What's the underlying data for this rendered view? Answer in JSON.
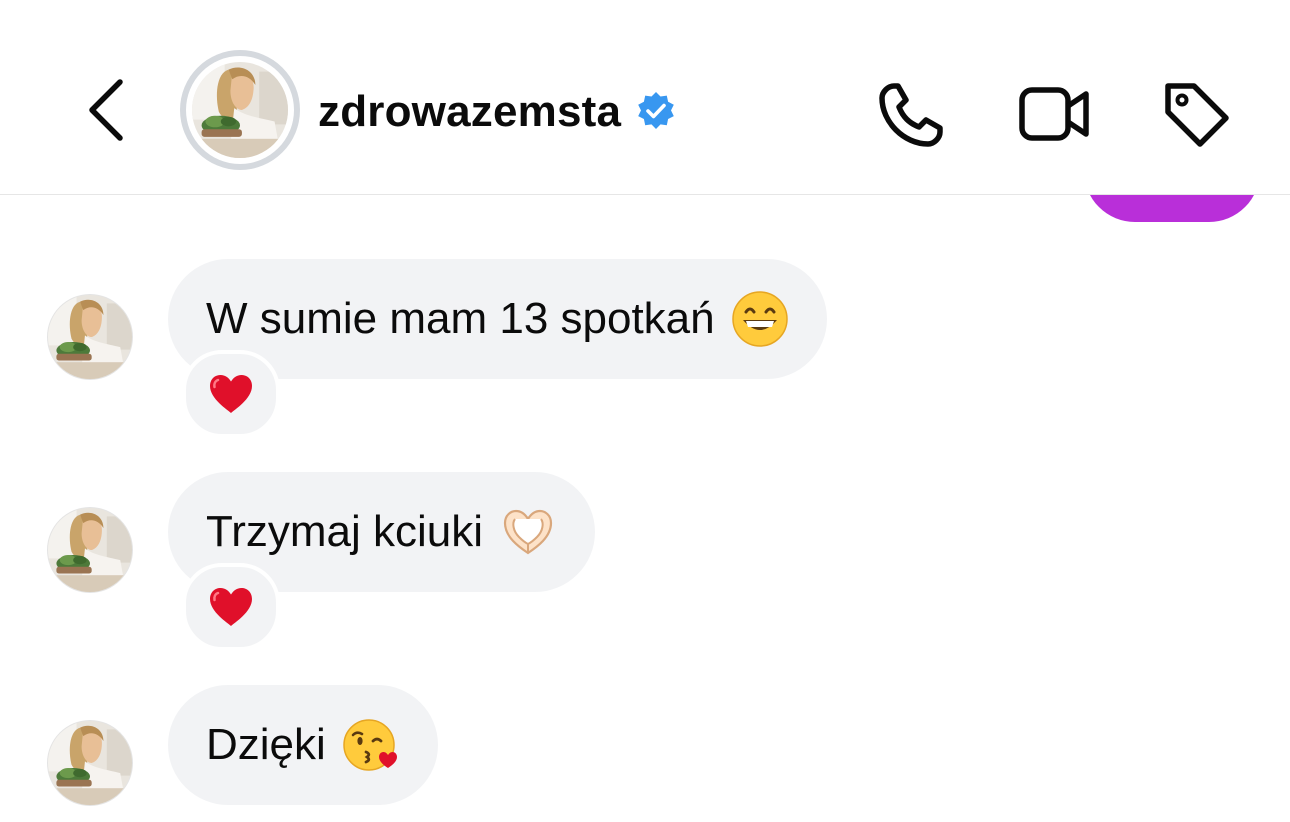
{
  "header": {
    "username": "zdrowazemsta",
    "verified": true,
    "icons": [
      "back-chevron-icon",
      "verified-badge-icon",
      "phone-icon",
      "video-camera-icon",
      "tag-icon"
    ]
  },
  "colors": {
    "verified_blue": "#3897f0",
    "bubble_gray": "#f2f3f5",
    "sent_purple": "#b92fd9",
    "heart_red": "#e0102a"
  },
  "messages": [
    {
      "text": "W sumie mam 13 spotkań",
      "emoji": "grinning-face-with-smiling-eyes",
      "reaction": "red-heart"
    },
    {
      "text": "Trzymaj kciuki",
      "emoji": "heart-hands",
      "reaction": "red-heart"
    },
    {
      "text": "Dzięki",
      "emoji": "face-blowing-a-kiss",
      "reaction": null
    }
  ]
}
